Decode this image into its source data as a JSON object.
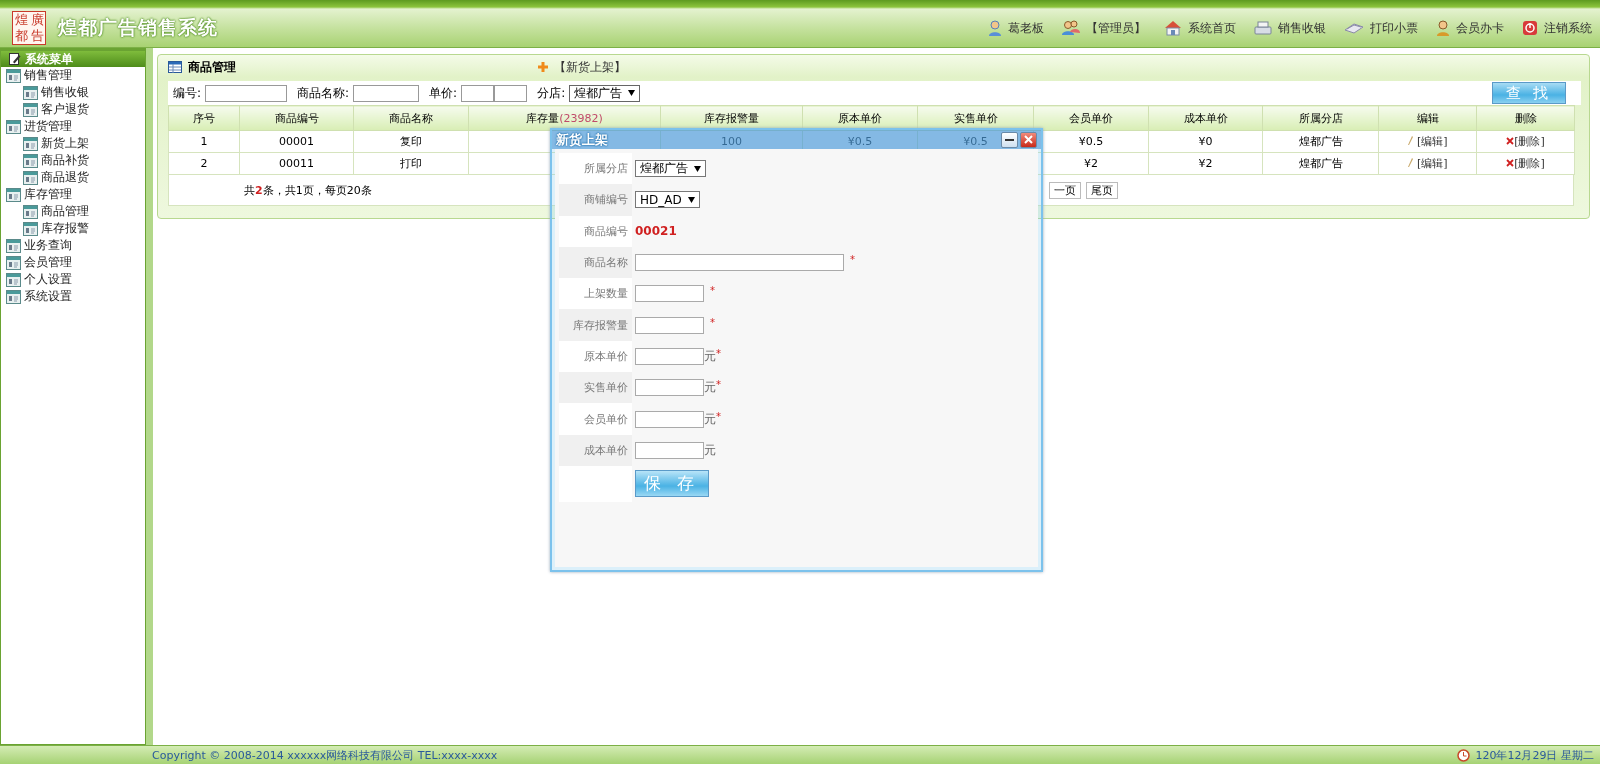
{
  "header": {
    "logo_seal": [
      "煌",
      "廣",
      "都",
      "告"
    ],
    "title": "煌都广告销售系统",
    "nav": [
      {
        "kind": "user",
        "label": "葛老板"
      },
      {
        "kind": "role",
        "label": "【管理员】"
      },
      {
        "kind": "home",
        "label": "系统首页"
      },
      {
        "kind": "cashier",
        "label": "销售收银"
      },
      {
        "kind": "print",
        "label": "打印小票"
      },
      {
        "kind": "card",
        "label": "会员办卡"
      },
      {
        "kind": "logout",
        "label": "注销系统"
      }
    ]
  },
  "sidebar": {
    "title": "系统菜单",
    "items": [
      {
        "label": "销售管理",
        "children": [
          {
            "label": "销售收银"
          },
          {
            "label": "客户退货"
          }
        ]
      },
      {
        "label": "进货管理",
        "children": [
          {
            "label": "新货上架"
          },
          {
            "label": "商品补货"
          },
          {
            "label": "商品退货"
          }
        ]
      },
      {
        "label": "库存管理",
        "children": [
          {
            "label": "商品管理"
          },
          {
            "label": "库存报警"
          }
        ]
      },
      {
        "label": "业务查询"
      },
      {
        "label": "会员管理"
      },
      {
        "label": "个人设置"
      },
      {
        "label": "系统设置"
      }
    ]
  },
  "panel": {
    "title": "商品管理",
    "add_link": "【新货上架】",
    "search": {
      "fields": [
        {
          "label": "编号:",
          "kind": "input"
        },
        {
          "label": "商品名称:",
          "kind": "input"
        },
        {
          "label": "单价:",
          "kind": "range"
        },
        {
          "label": "分店:",
          "kind": "select",
          "value": "煌都广告"
        }
      ],
      "button": "查 找"
    },
    "table": {
      "columns": [
        {
          "label": "序号"
        },
        {
          "label": "商品编号"
        },
        {
          "label": "商品名称"
        },
        {
          "label": "库存量",
          "count": "(23982)"
        },
        {
          "label": "库存报警量"
        },
        {
          "label": "原本单价"
        },
        {
          "label": "实售单价"
        },
        {
          "label": "会员单价"
        },
        {
          "label": "成本单价"
        },
        {
          "label": "所属分店"
        },
        {
          "label": "编辑"
        },
        {
          "label": "删除"
        }
      ],
      "rows": [
        {
          "cells": [
            "1",
            "00001",
            "复印",
            null,
            "100",
            "¥0.5",
            "¥0.5",
            "¥0.5",
            "¥0",
            "煌都广告"
          ],
          "edit": "[编辑]",
          "delete": "[删除]"
        },
        {
          "cells": [
            "2",
            "00011",
            "打印",
            null,
            null,
            null,
            null,
            "¥2",
            "¥2",
            "煌都广告"
          ],
          "edit": "[编辑]",
          "delete": "[删除]"
        }
      ]
    },
    "pagination": {
      "summary": "共**2**条，共1页，每页20条",
      "buttons": [
        "一页",
        "尾页"
      ]
    }
  },
  "dialog": {
    "title": "新货上架",
    "fields": [
      {
        "label": "所属分店",
        "kind": "select",
        "value": "煌都广告"
      },
      {
        "label": "商铺编号",
        "kind": "select",
        "value": "HD_AD"
      },
      {
        "label": "商品编号",
        "kind": "code",
        "value": "00021"
      },
      {
        "label": "商品名称",
        "kind": "wide-input",
        "required": true
      },
      {
        "label": "上架数量",
        "kind": "input",
        "required": true
      },
      {
        "label": "库存报警量",
        "kind": "input",
        "required": true
      },
      {
        "label": "原本单价",
        "kind": "input",
        "unit": "元",
        "required": true
      },
      {
        "label": "实售单价",
        "kind": "input",
        "unit": "元",
        "required": true
      },
      {
        "label": "会员单价",
        "kind": "input",
        "unit": "元",
        "required": true
      },
      {
        "label": "成本单价",
        "kind": "input",
        "unit": "元",
        "required": false
      }
    ],
    "required_mark": "*",
    "save_button": "保 存"
  },
  "footer": {
    "copyright": "Copyright © 2008-2014 xxxxxx网络科技有限公司 TEL:xxxx-xxxx",
    "date": "120年12月29日 星期二"
  }
}
